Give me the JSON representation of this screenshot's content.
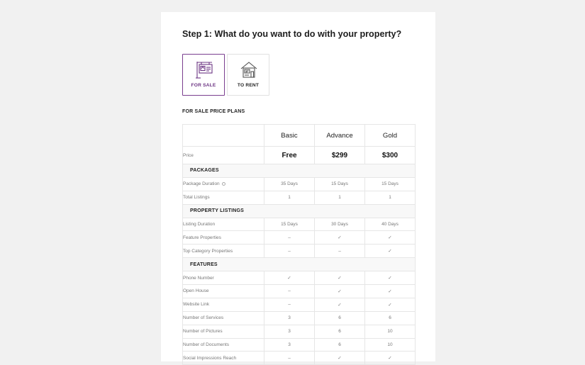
{
  "step_title": "Step 1: What do you want to do with your property?",
  "property_types": [
    {
      "label": "FOR SALE",
      "icon": "for-sale-sign-icon",
      "active": true
    },
    {
      "label": "TO RENT",
      "icon": "house-for-rent-icon",
      "active": false
    }
  ],
  "plans_title": "FOR SALE PRICE PLANS",
  "plans": [
    "Basic",
    "Advance",
    "Gold"
  ],
  "price_row": {
    "label": "Price",
    "values": [
      "Free",
      "$299",
      "$300"
    ]
  },
  "sections": [
    {
      "title": "PACKAGES",
      "rows": [
        {
          "label": "Package Duration",
          "info": true,
          "values": [
            "35 Days",
            "15 Days",
            "15 Days"
          ]
        },
        {
          "label": "Total Listings",
          "values": [
            "1",
            "1",
            "1"
          ]
        }
      ]
    },
    {
      "title": "PROPERTY LISTINGS",
      "rows": [
        {
          "label": "Listing Duration",
          "values": [
            "15 Days",
            "30 Days",
            "40 Days"
          ]
        },
        {
          "label": "Feature Properties",
          "values": [
            "–",
            "✓",
            "✓"
          ]
        },
        {
          "label": "Top Category Properties",
          "values": [
            "–",
            "–",
            "✓"
          ]
        }
      ]
    },
    {
      "title": "FEATURES",
      "rows": [
        {
          "label": "Phone Number",
          "values": [
            "✓",
            "✓",
            "✓"
          ]
        },
        {
          "label": "Open House",
          "values": [
            "–",
            "✓",
            "✓"
          ]
        },
        {
          "label": "Website Link",
          "values": [
            "–",
            "✓",
            "✓"
          ]
        },
        {
          "label": "Number of Services",
          "values": [
            "3",
            "6",
            "6"
          ]
        },
        {
          "label": "Number of Pictures",
          "values": [
            "3",
            "6",
            "10"
          ]
        },
        {
          "label": "Number of Documents",
          "values": [
            "3",
            "6",
            "10"
          ]
        },
        {
          "label": "Social Impressions Reach",
          "values": [
            "–",
            "✓",
            "✓"
          ]
        }
      ]
    }
  ],
  "colors": {
    "accent": "#6c3483",
    "check": "#2eb82e",
    "background": "#f1f1f1"
  }
}
